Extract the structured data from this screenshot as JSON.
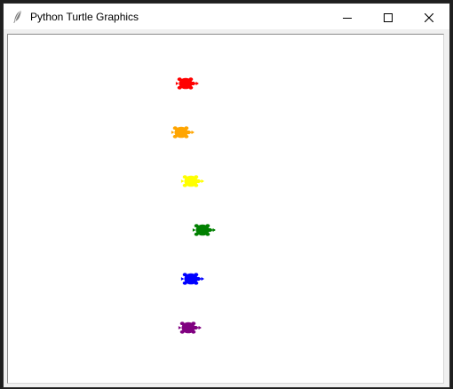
{
  "window": {
    "title": "Python Turtle Graphics",
    "app_icon": "feather-icon",
    "controls": [
      "minimize-icon",
      "maximize-icon",
      "close-icon"
    ]
  },
  "canvas": {
    "background": "#ffffff",
    "turtles": [
      {
        "name": "turtle-red",
        "color": "#ff0000"
      },
      {
        "name": "turtle-orange",
        "color": "#ffa500"
      },
      {
        "name": "turtle-yellow",
        "color": "#ffff00"
      },
      {
        "name": "turtle-green",
        "color": "#008000"
      },
      {
        "name": "turtle-blue",
        "color": "#0000ff"
      },
      {
        "name": "turtle-purple",
        "color": "#800080"
      }
    ]
  }
}
